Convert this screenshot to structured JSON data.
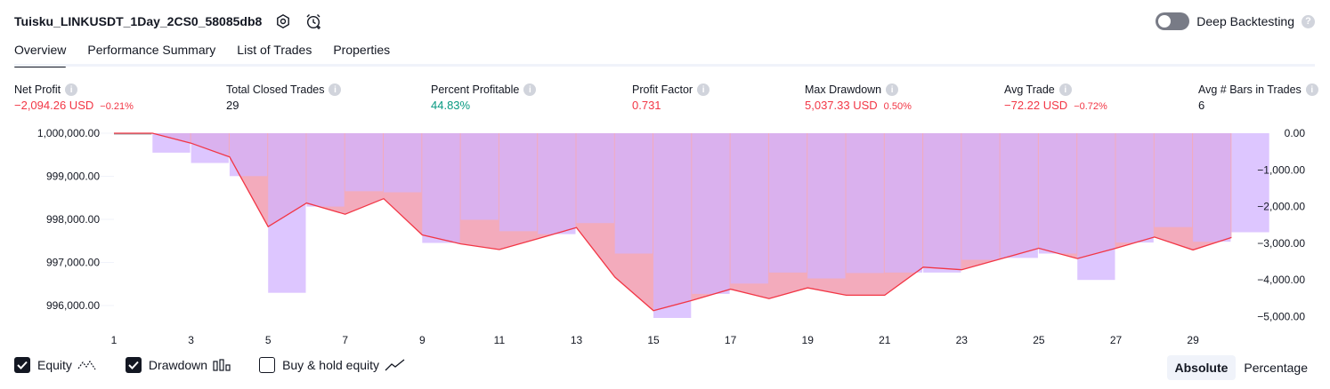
{
  "header": {
    "title": "Tuisku_LINKUSDT_1Day_2CS0_58085db8",
    "deep_backtesting_label": "Deep Backtesting",
    "deep_backtesting_on": false,
    "help_glyph": "?"
  },
  "tabs": [
    {
      "label": "Overview",
      "active": true
    },
    {
      "label": "Performance Summary"
    },
    {
      "label": "List of Trades"
    },
    {
      "label": "Properties"
    }
  ],
  "metrics": {
    "net_profit": {
      "label": "Net Profit",
      "value": "−2,094.26 USD",
      "sub": "−0.21%"
    },
    "total_closed_trades": {
      "label": "Total Closed Trades",
      "value": "29"
    },
    "percent_profitable": {
      "label": "Percent Profitable",
      "value": "44.83%"
    },
    "profit_factor": {
      "label": "Profit Factor",
      "value": "0.731"
    },
    "max_drawdown": {
      "label": "Max Drawdown",
      "value": "5,037.33 USD",
      "sub": "0.50%"
    },
    "avg_trade": {
      "label": "Avg Trade",
      "value": "−72.22 USD",
      "sub": "−0.72%"
    },
    "avg_bars": {
      "label": "Avg # Bars in Trades",
      "value": "6"
    }
  },
  "colors": {
    "negative": "#f23645",
    "positive": "#089981",
    "equity_line": "#f23645",
    "drawdown_bar": "#d1b3ff",
    "equity_fill_top": "#e3b4f5",
    "equity_fill_bottom": "#f195b4"
  },
  "chart_data": {
    "type": "bar",
    "equity": {
      "name": "Equity",
      "x": [
        1,
        2,
        3,
        4,
        5,
        6,
        7,
        8,
        9,
        10,
        11,
        12,
        13,
        14,
        15,
        16,
        17,
        18,
        19,
        20,
        21,
        22,
        23,
        24,
        25,
        26,
        27,
        28,
        29,
        30
      ],
      "values": [
        1000000.0,
        1000000.0,
        999770.0,
        999450.0,
        997830.0,
        998380.0,
        998120.0,
        998480.0,
        997640.0,
        997430.0,
        997300.0,
        997550.0,
        997810.0,
        996660.0,
        995880.0,
        996120.0,
        996380.0,
        996160.0,
        996410.0,
        996240.0,
        996240.0,
        996890.0,
        996830.0,
        997080.0,
        997330.0,
        997090.0,
        997330.0,
        997590.0,
        997290.0,
        997580.0
      ]
    },
    "drawdown": {
      "name": "Drawdown",
      "values": [
        0.0,
        -530.0,
        -810.0,
        -1170.0,
        -4350.0,
        -2000.0,
        -1580.0,
        -1610.0,
        -2990.0,
        -2360.0,
        -2670.0,
        -2750.0,
        -2450.0,
        -3280.0,
        -5037.33,
        -4380.0,
        -4100.0,
        -3800.0,
        -3960.0,
        -3810.0,
        -3800.0,
        -3800.0,
        -3450.0,
        -3400.0,
        -3280.0,
        -4000.0,
        -2980.0,
        -2560.0,
        -2960.0,
        -2700.0
      ]
    },
    "left_axis": {
      "ticks": [
        1000000,
        999000,
        998000,
        997000,
        996000
      ],
      "labels": [
        "1,000,000.00",
        "999,000.00",
        "998,000.00",
        "997,000.00",
        "996,000.00"
      ]
    },
    "right_axis": {
      "ticks": [
        0,
        -1000,
        -2000,
        -3000,
        -4000,
        -5000
      ],
      "labels": [
        "0.00",
        "−1,000.00",
        "−2,000.00",
        "−3,000.00",
        "−4,000.00",
        "−5,000.00"
      ]
    },
    "x_tick_labels": [
      "1",
      "3",
      "5",
      "7",
      "9",
      "11",
      "13",
      "15",
      "17",
      "19",
      "21",
      "23",
      "25",
      "27",
      "29"
    ]
  },
  "legend": {
    "equity": {
      "label": "Equity",
      "checked": true
    },
    "drawdown": {
      "label": "Drawdown",
      "checked": true
    },
    "buy_hold": {
      "label": "Buy & hold equity",
      "checked": false
    }
  },
  "modes": [
    {
      "label": "Absolute",
      "active": true
    },
    {
      "label": "Percentage",
      "active": false
    }
  ]
}
